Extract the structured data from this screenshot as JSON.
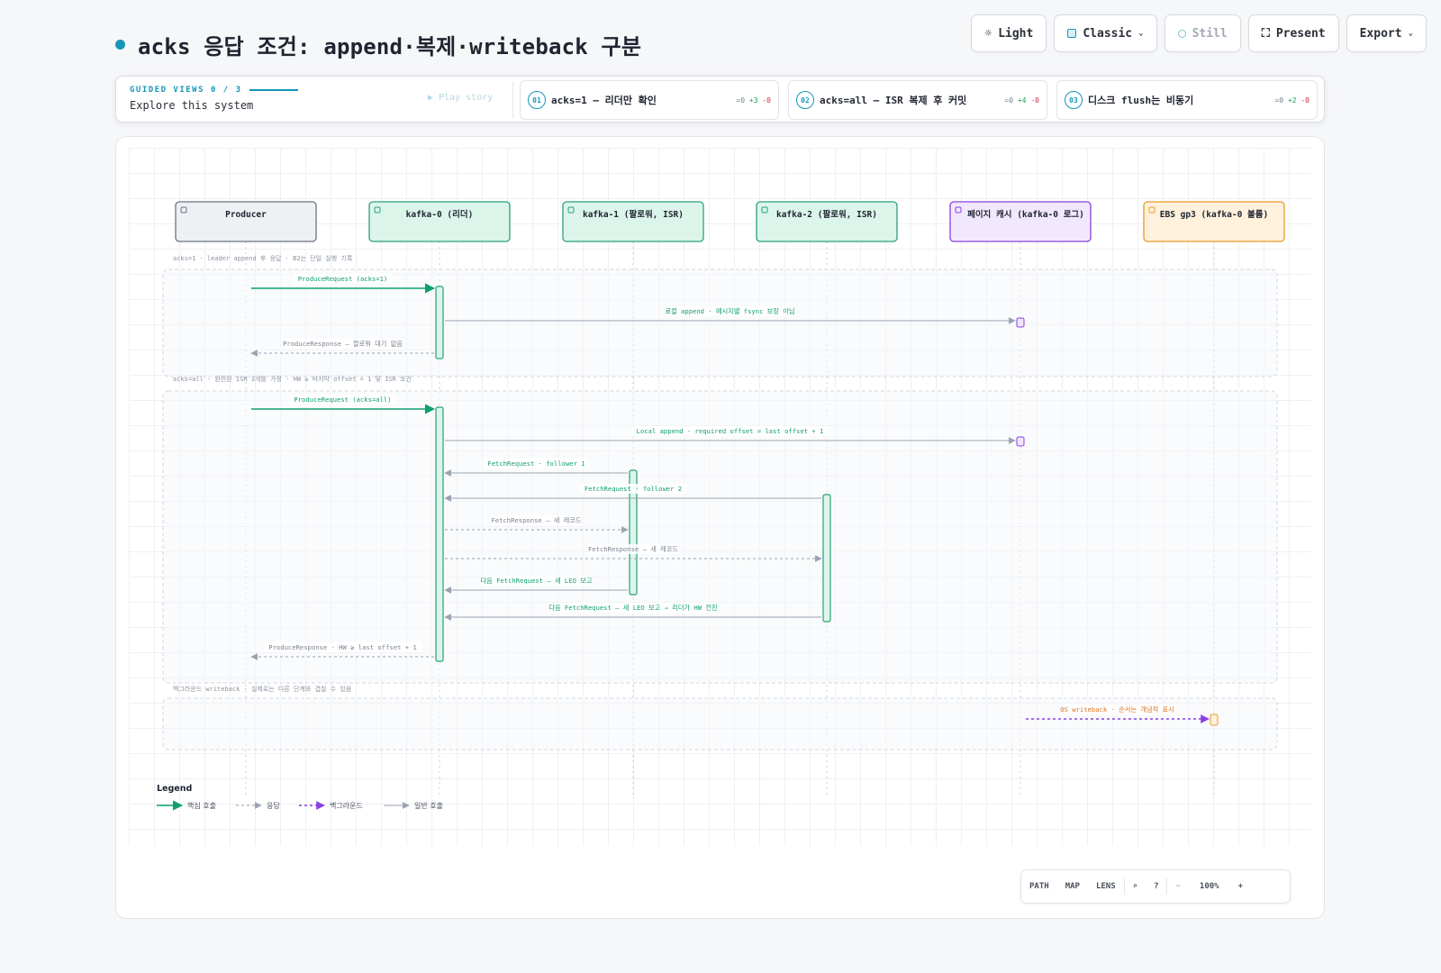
{
  "header": {
    "title": "acks 응답 조건: append·복제·writeback 구분"
  },
  "toolbar": {
    "light": "Light",
    "classic": "Classic",
    "still": "Still",
    "present": "Present",
    "export": "Export"
  },
  "guided": {
    "label": "GUIDED VIEWS 0 / 3",
    "subtitle": "Explore this system",
    "play": "Play story",
    "steps": [
      {
        "num": "01",
        "label": "acks=1 — 리더만 확인",
        "eq": "=0",
        "plus": "+3",
        "minus": "-0"
      },
      {
        "num": "02",
        "label": "acks=all — ISR 복제 후 커밋",
        "eq": "=0",
        "plus": "+4",
        "minus": "-0"
      },
      {
        "num": "03",
        "label": "디스크 flush는 비동기",
        "eq": "=0",
        "plus": "+2",
        "minus": "-0"
      }
    ]
  },
  "diagram": {
    "participants": [
      {
        "id": "producer",
        "label": "Producer",
        "kind": "client"
      },
      {
        "id": "k0",
        "label": "kafka-0 (리더)",
        "kind": "service"
      },
      {
        "id": "k1",
        "label": "kafka-1 (팔로워, ISR)",
        "kind": "service"
      },
      {
        "id": "k2",
        "label": "kafka-2 (팔로워, ISR)",
        "kind": "service"
      },
      {
        "id": "pc",
        "label": "페이지 캐시 (kafka-0 로그)",
        "kind": "store"
      },
      {
        "id": "ebs",
        "label": "EBS gp3 (kafka-0 볼륨)",
        "kind": "cloud"
      }
    ],
    "groups": [
      {
        "label": "acks=1 · leader append 후 응답 · B2는 단일 실행 기록"
      },
      {
        "label": "acks=all · 완전된 ISR 3개를 가정 · HW ≥ 마지막 offset + 1 및 ISR 조건"
      },
      {
        "label": "백그라운드 writeback · 실제로는 다른 단계와 겹칠 수 있음"
      }
    ],
    "messages": [
      {
        "from": "producer",
        "to": "k0",
        "label": "ProduceRequest (acks=1)",
        "style": "core"
      },
      {
        "from": "k0",
        "to": "pc",
        "label": "로컬 append · 메시지별 fsync 보장 아님",
        "style": "call"
      },
      {
        "from": "k0",
        "to": "producer",
        "label": "ProduceResponse — 팔로워 대기 없음",
        "style": "response"
      },
      {
        "from": "producer",
        "to": "k0",
        "label": "ProduceRequest (acks=all)",
        "style": "core"
      },
      {
        "from": "k0",
        "to": "pc",
        "label": "Local append · required offset = last offset + 1",
        "style": "call"
      },
      {
        "from": "k1",
        "to": "k0",
        "label": "FetchRequest · follower 1",
        "style": "call"
      },
      {
        "from": "k2",
        "to": "k0",
        "label": "FetchRequest · follower 2",
        "style": "call"
      },
      {
        "from": "k0",
        "to": "k1",
        "label": "FetchResponse — 새 레코드",
        "style": "response"
      },
      {
        "from": "k0",
        "to": "k2",
        "label": "FetchResponse — 새 레코드",
        "style": "response"
      },
      {
        "from": "k1",
        "to": "k0",
        "label": "다음 FetchRequest — 새 LEO 보고",
        "style": "call"
      },
      {
        "from": "k2",
        "to": "k0",
        "label": "다음 FetchRequest — 새 LEO 보고 → 리더가 HW 전진",
        "style": "call"
      },
      {
        "from": "k0",
        "to": "producer",
        "label": "ProduceResponse · HW ≥ last offset + 1",
        "style": "response"
      },
      {
        "from": "pc",
        "to": "ebs",
        "label": "OS writeback · 순서는 개념적 표시",
        "style": "background"
      }
    ],
    "legend": {
      "title": "Legend",
      "items": [
        {
          "style": "core",
          "label": "핵심 호출"
        },
        {
          "style": "response",
          "label": "응답"
        },
        {
          "style": "background",
          "label": "백그라운드"
        },
        {
          "style": "call",
          "label": "일반 호출"
        }
      ]
    },
    "colors": {
      "accent": "#1596b8",
      "core": "#0f9f6e",
      "call": "#9aa3b2",
      "background": "#8b3fe0",
      "service_fill": "#dcf5eb",
      "service_border": "#2aa176",
      "client_fill": "#eef0f4",
      "client_border": "#6b7280",
      "store_fill": "#f1e8fd",
      "store_border": "#8b3fe0",
      "cloud_fill": "#fff1dc",
      "cloud_border": "#e89a2c",
      "bg_label": "#e0731a"
    }
  },
  "zoom": {
    "path": "PATH",
    "map": "MAP",
    "lens": "LENS",
    "level": "100%"
  }
}
